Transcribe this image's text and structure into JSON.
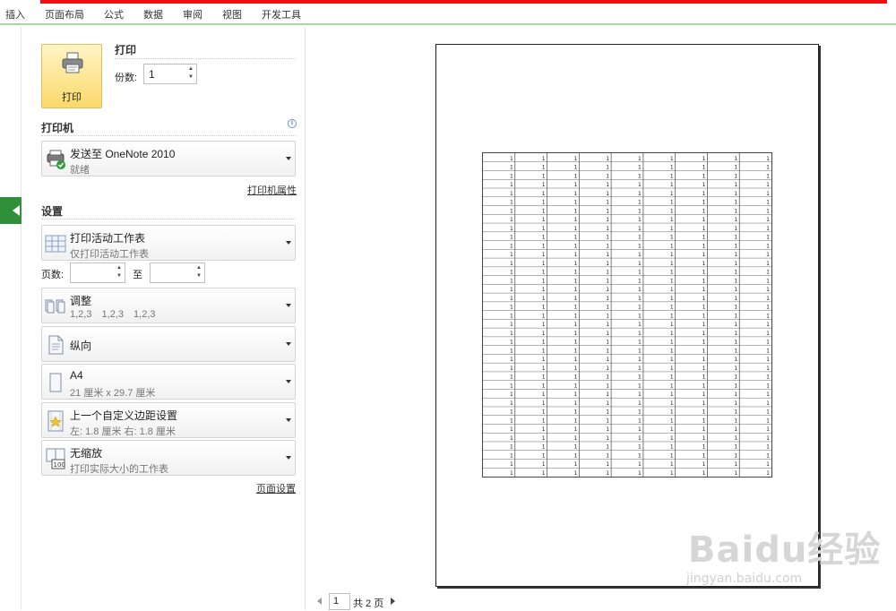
{
  "ribbon": {
    "tabs": [
      "插入",
      "页面布局",
      "公式",
      "数据",
      "审阅",
      "视图",
      "开发工具"
    ]
  },
  "print": {
    "section_title": "打印",
    "button_label": "打印",
    "copies_label": "份数:",
    "copies_value": "1"
  },
  "printer": {
    "section_title": "打印机",
    "name": "发送至 OneNote 2010",
    "status": "就绪",
    "properties_link": "打印机属性",
    "info_icon": "info-icon"
  },
  "settings": {
    "section_title": "设置",
    "what": {
      "title": "打印活动工作表",
      "subtitle": "仅打印活动工作表"
    },
    "pages_label": "页数:",
    "pages_to": "至",
    "pages_from_value": "",
    "pages_to_value": "",
    "collate": {
      "title": "调整",
      "subtitle": "1,2,3    1,2,3    1,2,3"
    },
    "orientation": {
      "title": "纵向"
    },
    "paper": {
      "title": "A4",
      "subtitle": "21 厘米 x 29.7 厘米"
    },
    "margins": {
      "title": "上一个自定义边距设置",
      "subtitle": "左:  1.8 厘米    右:  1.8 厘米"
    },
    "scaling": {
      "title": "无缩放",
      "subtitle": "打印实际大小的工作表"
    },
    "page_setup_link": "页面设置"
  },
  "preview": {
    "current_page": "1",
    "total_pages": "共 2 页",
    "sheet": {
      "rows": 37,
      "cols": 9,
      "cell_value": "1"
    }
  },
  "watermark": {
    "main": "Baidu经验",
    "sub": "jingyan.baidu.com"
  },
  "colors": {
    "accent_red": "#ee1111",
    "accent_green": "#2f8f3b",
    "print_button": "#fbd96a"
  }
}
